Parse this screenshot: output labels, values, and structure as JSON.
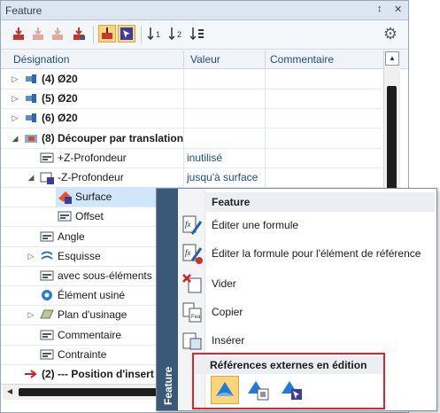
{
  "panel": {
    "title": "Feature",
    "pin_glyph": "↕",
    "close_glyph": "✕"
  },
  "toolbar": {
    "buttons": [
      {
        "icon": "insert-feature-icon"
      },
      {
        "icon": "insert-feature-disabled-icon"
      },
      {
        "icon": "insert-feature-disabled-2-icon"
      },
      {
        "icon": "insert-feature-3-icon"
      },
      {
        "icon": "feature-bar-icon",
        "active": true
      },
      {
        "icon": "cursor-select-icon",
        "active": true
      },
      {
        "icon": "sort-1-icon"
      },
      {
        "icon": "sort-2-icon"
      },
      {
        "icon": "sort-3-icon"
      }
    ],
    "gear_glyph": "⚙"
  },
  "columns": {
    "name": "Désignation",
    "value": "Valeur",
    "comment": "Commentaire"
  },
  "rows": [
    {
      "label": "(4)  Ø20",
      "bold": true,
      "value": "",
      "icon": "bolt-icon",
      "expander": "▷"
    },
    {
      "label": "(5)  Ø20",
      "bold": true,
      "value": "",
      "icon": "bolt-icon",
      "expander": "▷"
    },
    {
      "label": "(6)  Ø20",
      "bold": true,
      "value": "",
      "icon": "bolt-icon",
      "expander": "▷"
    },
    {
      "label": "(8) Découper par translation",
      "bold": true,
      "value": "",
      "icon": "cut-extrude-icon",
      "expander": "◢"
    },
    {
      "label": "+Z-Profondeur",
      "bold": false,
      "value": "inutilisé",
      "icon": "parameter-icon",
      "expander": ""
    },
    {
      "label": "-Z-Profondeur",
      "bold": false,
      "value": "jusqu'à surface",
      "icon": "parameter-ref-icon",
      "expander": "◢"
    },
    {
      "label": "Surface",
      "bold": false,
      "value": "",
      "icon": "surface-ref-icon",
      "expander": ""
    },
    {
      "label": "Offset",
      "bold": false,
      "value": "",
      "icon": "parameter-icon",
      "expander": ""
    },
    {
      "label": "Angle",
      "bold": false,
      "value": "",
      "icon": "parameter-icon",
      "expander": ""
    },
    {
      "label": "Esquisse",
      "bold": false,
      "value": "",
      "icon": "sketch-icon",
      "expander": "▷"
    },
    {
      "label": "avec sous-éléments",
      "bold": false,
      "value": "",
      "icon": "parameter-icon",
      "expander": ""
    },
    {
      "label": "Élément usiné",
      "bold": false,
      "value": "",
      "icon": "machined-gear-icon",
      "expander": ""
    },
    {
      "label": "Plan d'usinage",
      "bold": false,
      "value": "",
      "icon": "plane-icon",
      "expander": "▷"
    },
    {
      "label": "Commentaire",
      "bold": false,
      "value": "",
      "icon": "parameter-icon",
      "expander": ""
    },
    {
      "label": "Contrainte",
      "bold": false,
      "value": "",
      "icon": "parameter-icon",
      "expander": ""
    },
    {
      "label": "(2) --- Position  d'insert",
      "bold": true,
      "value": "",
      "icon": "red-arrow-icon",
      "expander": ""
    }
  ],
  "menu": {
    "side_label": "Feature",
    "header": "Feature",
    "items": [
      {
        "label": "Éditer une formule",
        "icon": "formula-edit-icon"
      },
      {
        "label": "Éditer la formule pour l'élément de référence",
        "icon": "formula-ref-edit-icon"
      },
      {
        "label": "Vider",
        "icon": "clear-icon"
      },
      {
        "label": "Copier",
        "icon": "copy-icon"
      },
      {
        "label": "Insérer",
        "icon": "paste-icon"
      }
    ],
    "ext_header": "Références externes en édition",
    "ext_buttons": [
      {
        "icon": "ext-ref-active-icon",
        "active": true
      },
      {
        "icon": "ext-ref-doc-icon",
        "active": false
      },
      {
        "icon": "ext-ref-select-icon",
        "active": false
      }
    ]
  }
}
